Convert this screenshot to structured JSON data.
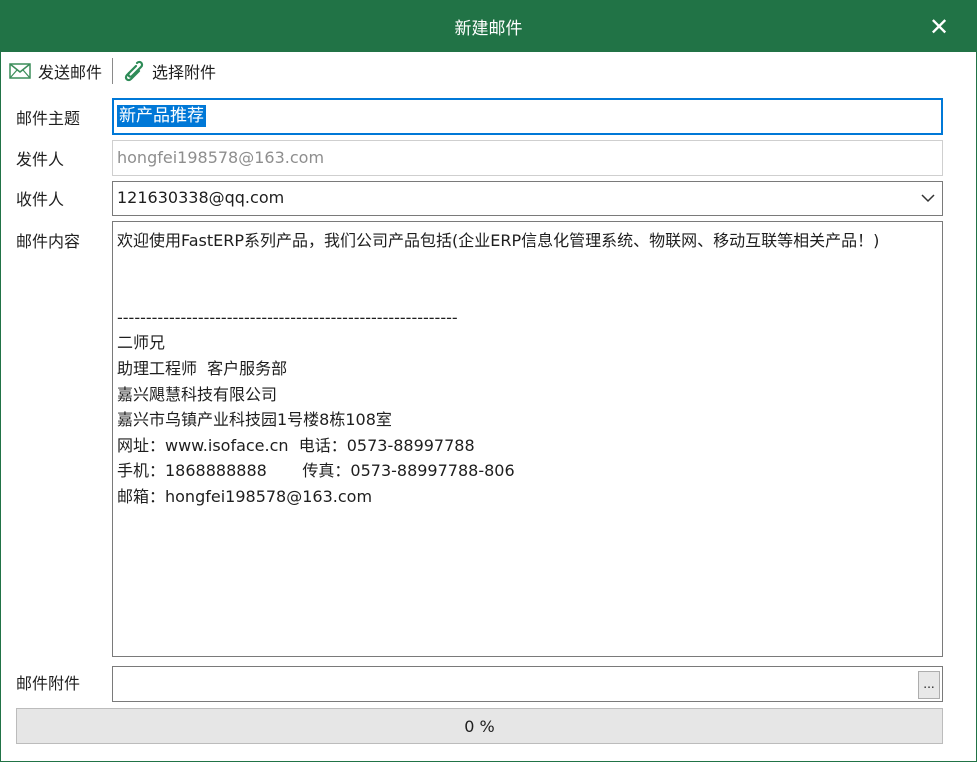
{
  "window": {
    "title": "新建邮件",
    "accent": "#217346"
  },
  "toolbar": {
    "send": {
      "label": "发送邮件",
      "icon": "envelope-icon"
    },
    "attach": {
      "label": "选择附件",
      "icon": "paperclip-icon"
    }
  },
  "form": {
    "subject_label": "邮件主题",
    "subject_value": "新产品推荐",
    "sender_label": "发件人",
    "sender_value": "hongfei198578@163.com",
    "recipient_label": "收件人",
    "recipient_value": "121630338@qq.com",
    "content_label": "邮件内容",
    "content_value": "欢迎使用FastERP系列产品，我们公司产品包括(企业ERP信息化管理系统、物联网、移动互联等相关产品！)\n\n\n-----------------------------------------------------------\n二师兄\n助理工程师  客户服务部\n嘉兴飓慧科技有限公司\n嘉兴市乌镇产业科技园1号楼8栋108室\n网址：www.isoface.cn  电话：0573-88997788\n手机：1868888888       传真：0573-88997788-806\n邮箱：hongfei198578@163.com",
    "attachment_label": "邮件附件",
    "attachment_value": "",
    "browse_label": "..."
  },
  "progress": {
    "value": 0,
    "text": "0 %"
  }
}
